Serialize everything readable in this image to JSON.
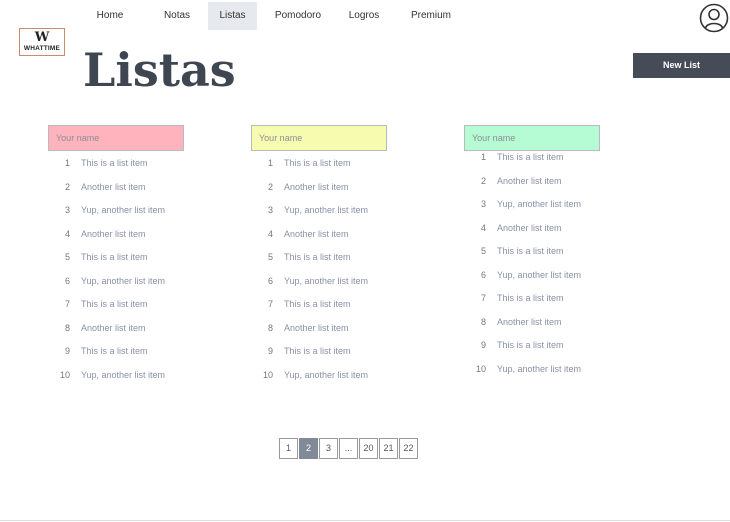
{
  "nav": {
    "items": [
      {
        "label": "Home"
      },
      {
        "label": "Notas"
      },
      {
        "label": "Listas"
      },
      {
        "label": "Pomodoro"
      },
      {
        "label": "Logros"
      },
      {
        "label": "Premium"
      }
    ],
    "active": "Listas"
  },
  "logo": {
    "letter": "W",
    "text": "WHATTIME"
  },
  "page": {
    "title": "Listas"
  },
  "toolbar": {
    "new_list_label": "New List"
  },
  "lists": [
    {
      "header_placeholder": "Your name",
      "header_color": "#ffb3bd",
      "items": [
        {
          "num": "1",
          "text": "This is a list item"
        },
        {
          "num": "2",
          "text": "Another list item"
        },
        {
          "num": "3",
          "text": "Yup, another list item"
        },
        {
          "num": "4",
          "text": "Another list item"
        },
        {
          "num": "5",
          "text": "This is a list item"
        },
        {
          "num": "6",
          "text": "Yup, another list item"
        },
        {
          "num": "7",
          "text": "This is a list item"
        },
        {
          "num": "8",
          "text": "Another list item"
        },
        {
          "num": "9",
          "text": "This is a list item"
        },
        {
          "num": "10",
          "text": "Yup, another list item"
        }
      ]
    },
    {
      "header_placeholder": "Your name",
      "header_color": "#f7fbb0",
      "items": [
        {
          "num": "1",
          "text": "This is a list item"
        },
        {
          "num": "2",
          "text": "Another list item"
        },
        {
          "num": "3",
          "text": "Yup, another list item"
        },
        {
          "num": "4",
          "text": "Another list item"
        },
        {
          "num": "5",
          "text": "This is a list item"
        },
        {
          "num": "6",
          "text": "Yup, another list item"
        },
        {
          "num": "7",
          "text": "This is a list item"
        },
        {
          "num": "8",
          "text": "Another list item"
        },
        {
          "num": "9",
          "text": "This is a list item"
        },
        {
          "num": "10",
          "text": "Yup, another list item"
        }
      ]
    },
    {
      "header_placeholder": "Your name",
      "header_color": "#b5fbd3",
      "items": [
        {
          "num": "1",
          "text": "This is a list item"
        },
        {
          "num": "2",
          "text": "Another list item"
        },
        {
          "num": "3",
          "text": "Yup, another list item"
        },
        {
          "num": "4",
          "text": "Another list item"
        },
        {
          "num": "5",
          "text": "This is a list item"
        },
        {
          "num": "6",
          "text": "Yup, another list item"
        },
        {
          "num": "7",
          "text": "This is a list item"
        },
        {
          "num": "8",
          "text": "Another list item"
        },
        {
          "num": "9",
          "text": "This is a list item"
        },
        {
          "num": "10",
          "text": "Yup, another list item"
        }
      ]
    }
  ],
  "pagination": {
    "pages": [
      "1",
      "2",
      "3",
      "...",
      "20",
      "21",
      "22"
    ],
    "current": "2"
  },
  "colors": {
    "accent_dark": "#454c57",
    "title": "#3e4652",
    "pager_active": "#808a99"
  }
}
